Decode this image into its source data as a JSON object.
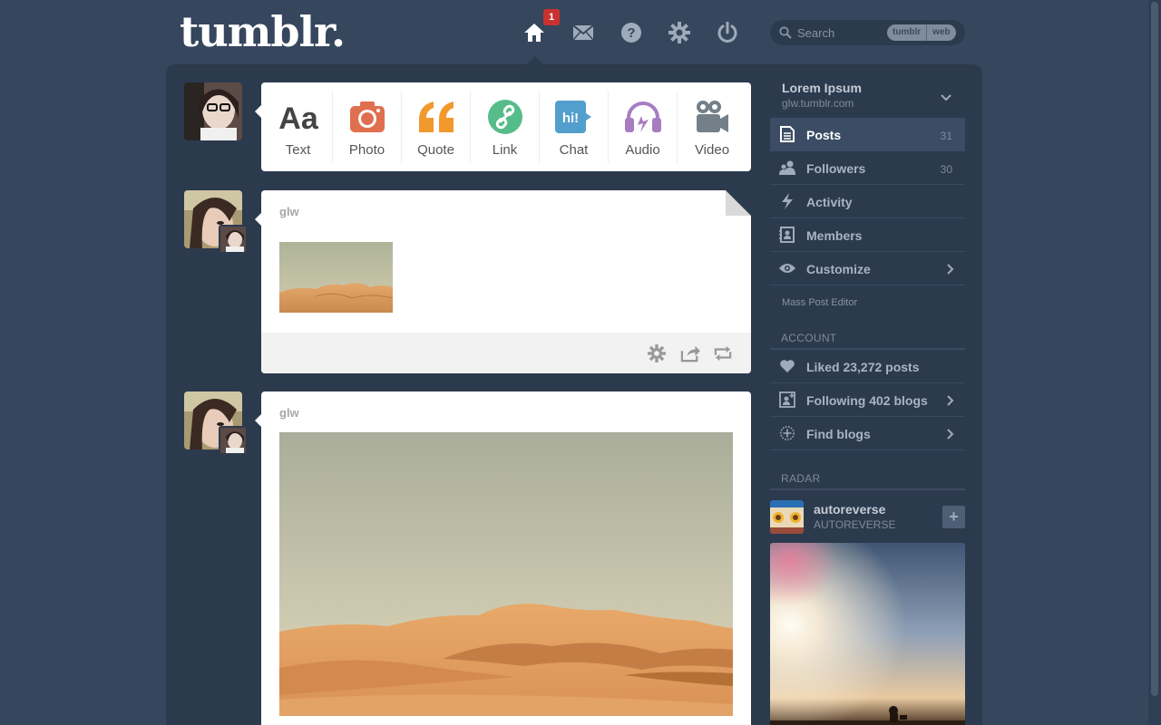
{
  "brand": {
    "logo": "tumblr."
  },
  "nav": {
    "home_badge": "1",
    "icons": [
      "home-icon",
      "mail-icon",
      "help-icon",
      "gear-icon",
      "power-icon"
    ]
  },
  "search": {
    "placeholder": "Search",
    "scope_options": [
      "tumblr",
      "web"
    ]
  },
  "composer": {
    "types": [
      {
        "label": "Text",
        "icon": "text-icon",
        "color": "#444444"
      },
      {
        "label": "Photo",
        "icon": "camera-icon",
        "color": "#e06f4f"
      },
      {
        "label": "Quote",
        "icon": "quote-icon",
        "color": "#f2992e"
      },
      {
        "label": "Link",
        "icon": "link-icon",
        "color": "#56bc8a"
      },
      {
        "label": "Chat",
        "icon": "chat-icon",
        "color": "#529ecc"
      },
      {
        "label": "Audio",
        "icon": "headphones-icon",
        "color": "#a77dc2"
      },
      {
        "label": "Video",
        "icon": "video-camera-icon",
        "color": "#748089"
      }
    ]
  },
  "posts": [
    {
      "author": "glw",
      "image": "desert-dunes-thumbnail"
    },
    {
      "author": "glw",
      "image": "desert-dunes-photo"
    }
  ],
  "sidebar": {
    "blog": {
      "name": "Lorem Ipsum",
      "url": "glw.tumblr.com"
    },
    "items": [
      {
        "label": "Posts",
        "count": "31",
        "icon": "document-icon"
      },
      {
        "label": "Followers",
        "count": "30",
        "icon": "people-icon"
      },
      {
        "label": "Activity",
        "count": "",
        "icon": "lightning-icon"
      },
      {
        "label": "Members",
        "count": "",
        "icon": "contact-card-icon"
      },
      {
        "label": "Customize",
        "count": "",
        "icon": "eye-icon"
      }
    ],
    "mass_post_editor": "Mass Post Editor",
    "account_heading": "ACCOUNT",
    "account_items": [
      {
        "label": "Liked 23,272 posts",
        "icon": "heart-icon"
      },
      {
        "label": "Following 402 blogs",
        "icon": "add-person-icon"
      },
      {
        "label": "Find blogs",
        "icon": "compass-icon"
      }
    ],
    "radar_heading": "RADAR",
    "radar": {
      "name": "autoreverse",
      "subtitle": "AUTOREVERSE",
      "follow": "+"
    }
  },
  "colors": {
    "background": "#36465d",
    "panel": "#2c3a4e",
    "badge": "#c9322f"
  }
}
